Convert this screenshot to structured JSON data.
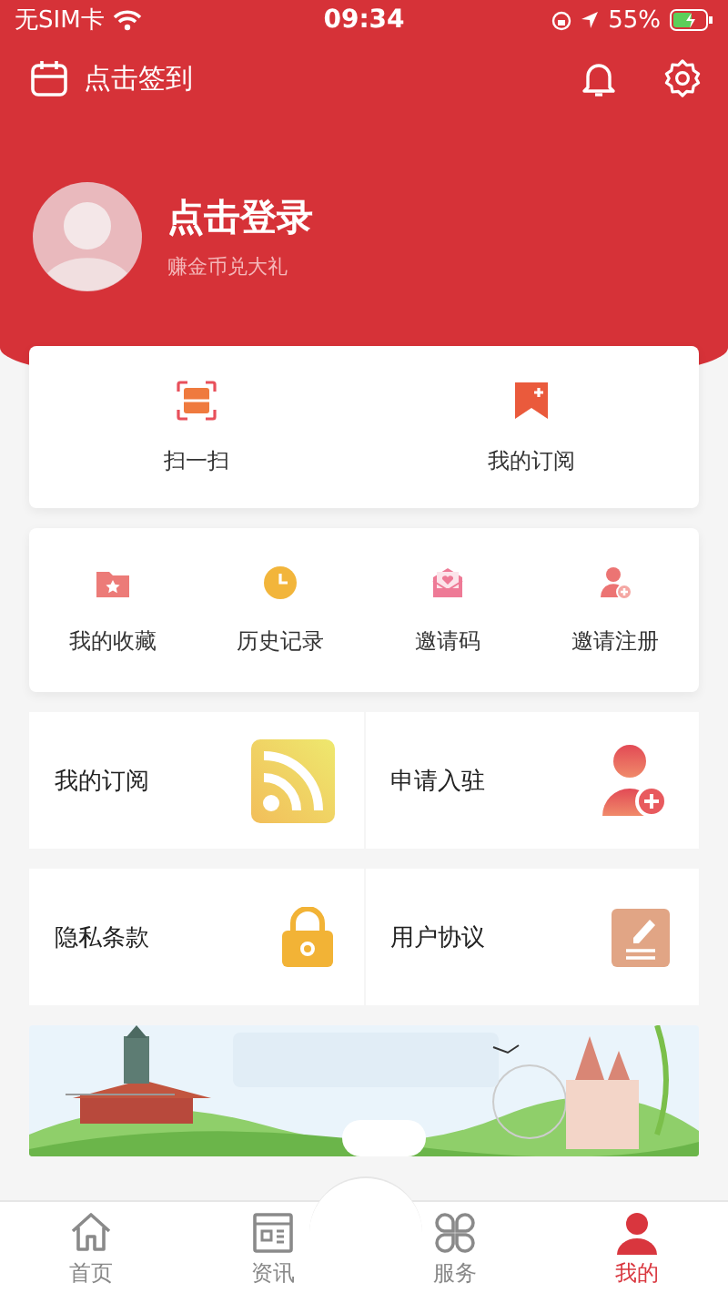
{
  "status_bar": {
    "carrier": "无SIM卡",
    "time": "09:34",
    "battery": "55%"
  },
  "header": {
    "checkin": "点击签到"
  },
  "profile": {
    "title": "点击登录",
    "subtitle": "赚金币兑大礼"
  },
  "quick_actions": [
    {
      "label": "扫一扫"
    },
    {
      "label": "我的订阅"
    }
  ],
  "shortcuts": [
    {
      "label": "我的收藏"
    },
    {
      "label": "历史记录"
    },
    {
      "label": "邀请码"
    },
    {
      "label": "邀请注册"
    }
  ],
  "tiles": [
    {
      "label": "我的订阅"
    },
    {
      "label": "申请入驻"
    },
    {
      "label": "隐私条款"
    },
    {
      "label": "用户协议"
    }
  ],
  "tab_bar": [
    {
      "label": "首页",
      "selected": false
    },
    {
      "label": "资讯",
      "selected": false
    },
    {
      "label": "服务",
      "selected": false
    },
    {
      "label": "我的",
      "selected": true
    }
  ]
}
